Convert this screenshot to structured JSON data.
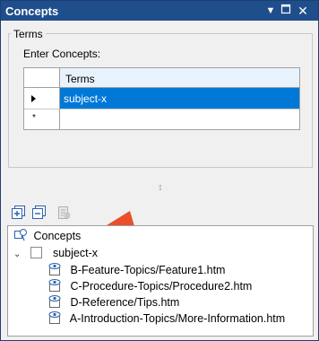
{
  "window": {
    "title": "Concepts"
  },
  "terms_group": {
    "label": "Terms",
    "enter_label": "Enter Concepts:",
    "grid": {
      "column_header": "Terms",
      "rows": [
        {
          "value": "subject-x",
          "selected": true
        },
        {
          "value": "",
          "new_row_marker": "*"
        }
      ]
    }
  },
  "toolbar": {
    "icons": [
      "expand-all-icon",
      "collapse-all-icon",
      "insert-topic-icon"
    ]
  },
  "tree": {
    "root_label": "Concepts",
    "concept": {
      "label": "subject-x",
      "expander": "chevron-down",
      "topics": [
        "B-Feature-Topics/Feature1.htm",
        "C-Procedure-Topics/Procedure2.htm",
        "D-Reference/Tips.htm",
        "A-Introduction-Topics/More-Information.htm"
      ]
    }
  },
  "colors": {
    "titlebar": "#1f4e8c",
    "selection": "#0078d7",
    "callout_arrow": "#e8512a"
  }
}
